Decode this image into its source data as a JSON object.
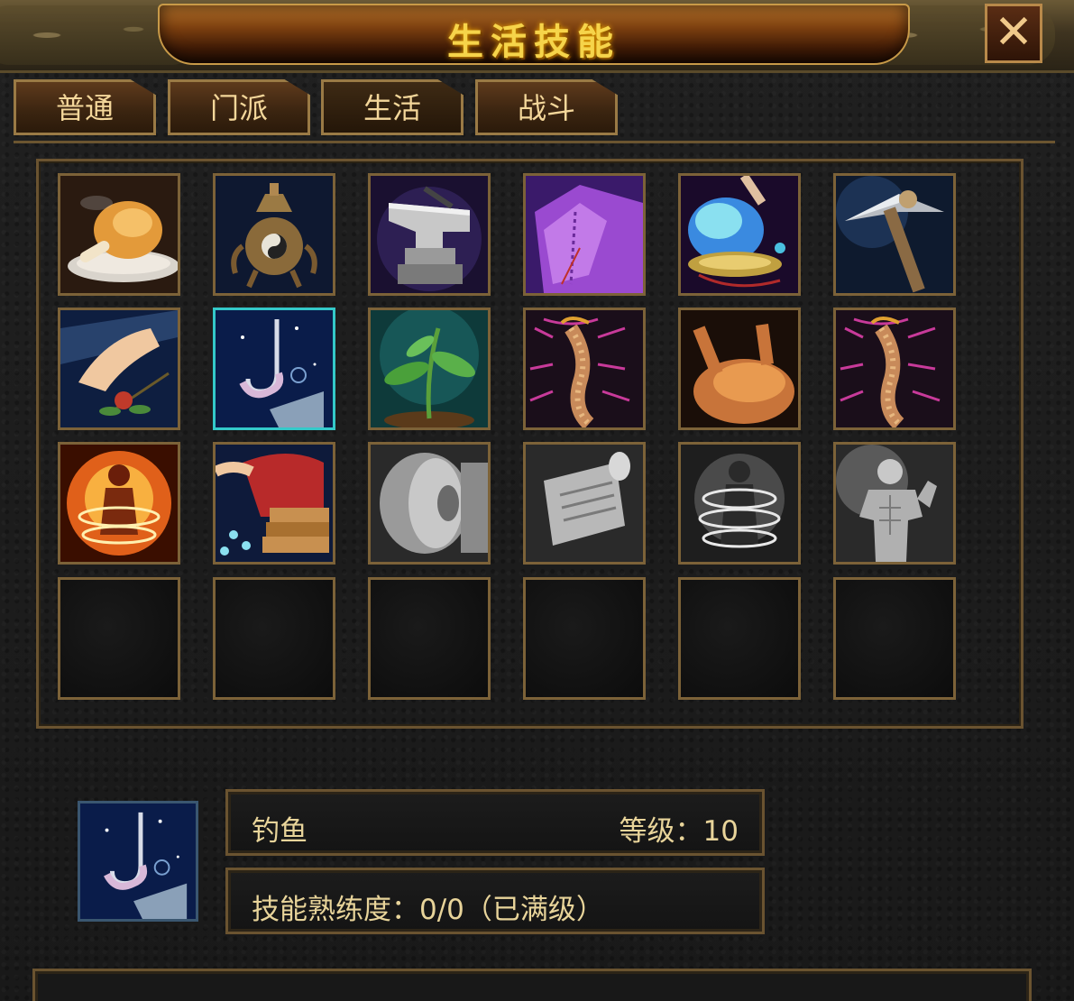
{
  "window": {
    "title": "生活技能",
    "close_label": "✕"
  },
  "tabs": [
    {
      "label": "普通"
    },
    {
      "label": "门派"
    },
    {
      "label": "生活"
    },
    {
      "label": "战斗"
    }
  ],
  "active_tab": "生活",
  "skills": [
    {
      "icon": "roast-chicken-leg-icon"
    },
    {
      "icon": "bronze-censer-icon"
    },
    {
      "icon": "anvil-icon"
    },
    {
      "icon": "purple-robe-icon"
    },
    {
      "icon": "alchemy-flask-icon"
    },
    {
      "icon": "pickaxe-icon"
    },
    {
      "icon": "herb-picking-icon"
    },
    {
      "icon": "fishing-hook-icon",
      "selected": true
    },
    {
      "icon": "sprout-icon"
    },
    {
      "icon": "centipede-icon"
    },
    {
      "icon": "roast-chicken-icon"
    },
    {
      "icon": "centipede-icon"
    },
    {
      "icon": "fiery-aura-body-icon"
    },
    {
      "icon": "tailoring-icon"
    },
    {
      "icon": "whetstone-icon"
    },
    {
      "icon": "scroll-icon"
    },
    {
      "icon": "aura-body-icon"
    },
    {
      "icon": "muscle-man-icon"
    },
    {
      "icon": "empty-slot"
    },
    {
      "icon": "empty-slot"
    },
    {
      "icon": "empty-slot"
    },
    {
      "icon": "empty-slot"
    },
    {
      "icon": "empty-slot"
    },
    {
      "icon": "empty-slot"
    }
  ],
  "selected_skill": {
    "icon": "fishing-hook-icon",
    "name": "钓鱼",
    "level_text": "等级：10",
    "proficiency_text": "技能熟练度：0/0（已满级）"
  },
  "colors": {
    "title_gold": "#f6d44a",
    "tab_text": "#f4d79a",
    "frame_bronze": "#7c6238",
    "selected_border": "#34c9c9",
    "info_text": "#e8d49a"
  }
}
